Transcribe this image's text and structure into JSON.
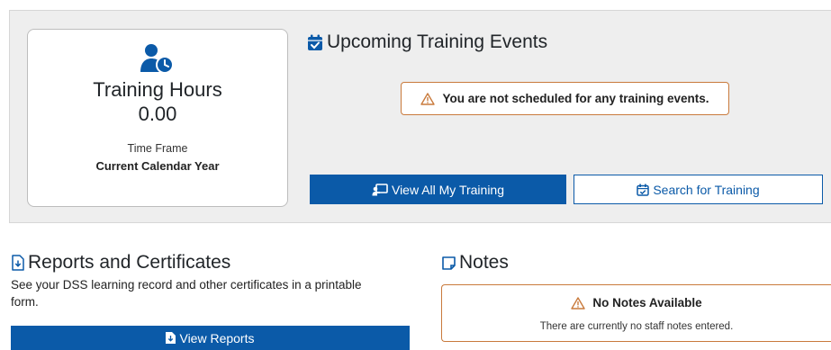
{
  "training_hours": {
    "title": "Training Hours",
    "value": "0.00",
    "time_frame_label": "Time Frame",
    "time_frame_value": "Current Calendar Year"
  },
  "upcoming_events": {
    "heading": "Upcoming Training Events",
    "alert": "You are not scheduled for any training events.",
    "view_all_label": "View All My Training",
    "search_label": "Search for Training"
  },
  "reports": {
    "heading": "Reports and Certificates",
    "description": "See your DSS learning record and other certificates in a printable form.",
    "button_label": "View Reports"
  },
  "notes": {
    "heading": "Notes",
    "alert_title": "No Notes Available",
    "alert_text": "There are currently no staff notes entered."
  },
  "colors": {
    "primary": "#0b5aa8",
    "warning_border": "#c97a3c",
    "panel_bg": "#eeeeee"
  },
  "icons": [
    "user-clock-icon",
    "calendar-check-icon",
    "warning-triangle-icon",
    "chalkboard-teacher-icon",
    "calendar-search-icon",
    "file-download-icon",
    "file-icon",
    "sticky-note-icon"
  ]
}
